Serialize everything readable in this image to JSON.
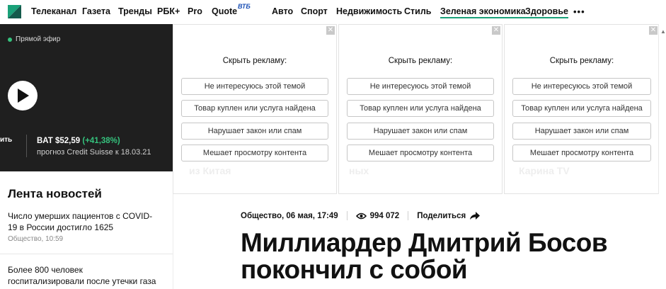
{
  "nav": {
    "items": [
      "Телеканал",
      "Газета",
      "Тренды",
      "РБК+",
      "Pro",
      "Quote",
      "Авто",
      "Спорт",
      "Недвижимость",
      "Стиль",
      "Зеленая экономика",
      "Здоровье"
    ],
    "vtb_badge": "ВТБ",
    "more": "•••"
  },
  "video": {
    "live_label": "Прямой эфир",
    "ticker_button": "ить",
    "ticker_name": "BAT $52,59",
    "ticker_change": "(+41,38%)",
    "ticker_sub": "прогноз Credit Suisse к 18.03.21"
  },
  "ads": [
    {
      "title": "Скрыть рекламу:",
      "options": [
        "Не интересуюсь этой темой",
        "Товар куплен или услуга найдена",
        "Нарушает закон или спам",
        "Мешает просмотру контента"
      ]
    },
    {
      "title": "Скрыть рекламу:",
      "options": [
        "Не интересуюсь этой темой",
        "Товар куплен или услуга найдена",
        "Нарушает закон или спам",
        "Мешает просмотру контента"
      ]
    },
    {
      "title": "Скрыть рекламу:",
      "options": [
        "Не интересуюсь этой темой",
        "Товар куплен или услуга найдена",
        "Нарушает закон или спам",
        "Мешает просмотру контента"
      ]
    }
  ],
  "ad_close": "✕",
  "ghost": [
    "из Китая",
    "ных",
    "Карина TV"
  ],
  "feed": {
    "title": "Лента новостей",
    "items": [
      {
        "text": "Число умерших пациентов с COVID-19 в России достигло 1625",
        "meta": "Общество, 10:59"
      },
      {
        "text": "Более 800 человек госпитализировали после утечки газа",
        "meta": ""
      }
    ]
  },
  "article": {
    "category_time": "Общество, 06 мая, 17:49",
    "views": "994 072",
    "share": "Поделиться",
    "headline": "Миллиардер Дмитрий Босов покончил с собой"
  },
  "colors": {
    "accent_green": "#1aa179",
    "positive": "#35c27d",
    "dark_panel": "#1f1f1f"
  }
}
